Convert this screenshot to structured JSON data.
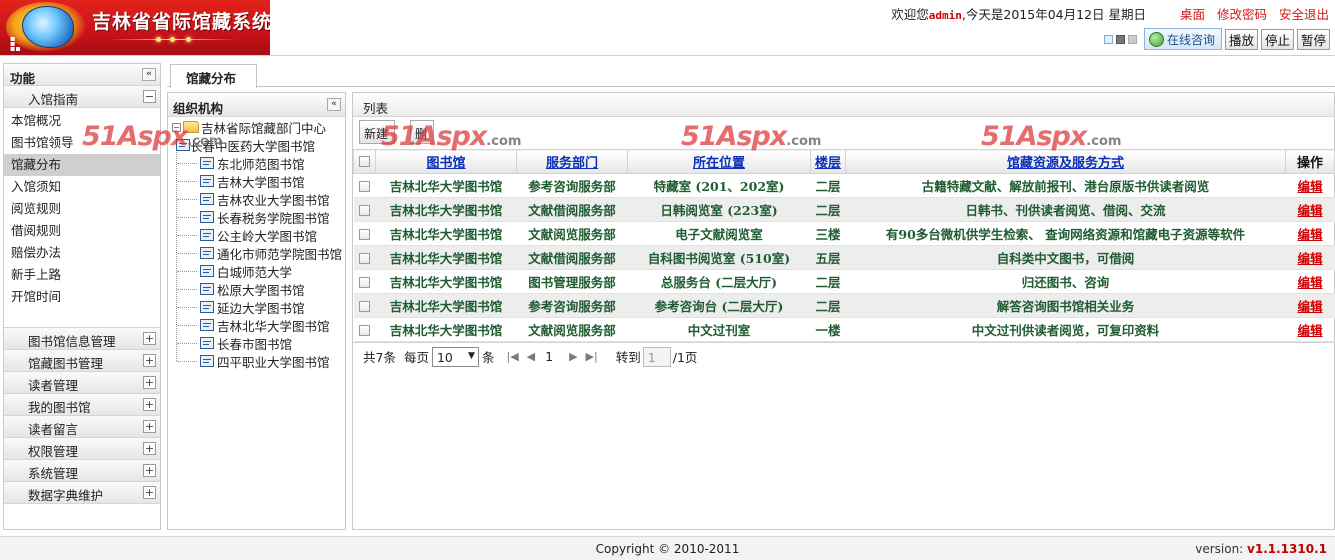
{
  "header": {
    "logo_title": "吉林省省际馆藏系统",
    "welcome_prefix": "欢迎您",
    "username": "admin",
    "date_text": ",今天是2015年04月12日  星期日",
    "links": [
      "桌面",
      "修改密码",
      "安全退出"
    ],
    "consult_label": "在线咨询",
    "play_label": "播放",
    "stop_label": "停止",
    "pause_label": "暂停"
  },
  "leftnav": {
    "title": "功能",
    "guide_title": "入馆指南",
    "guide_items": [
      "本馆概况",
      "图书馆领导",
      "馆藏分布",
      "入馆须知",
      "阅览规则",
      "借阅规则",
      "赔偿办法",
      "新手上路",
      "开馆时间"
    ],
    "sections": [
      "图书馆信息管理",
      "馆藏图书管理",
      "读者管理",
      "我的图书馆",
      "读者留言",
      "权限管理",
      "系统管理",
      "数据字典维护"
    ]
  },
  "tab": {
    "label": "馆藏分布"
  },
  "tree": {
    "title": "组织机构",
    "root": "吉林省际馆藏部门中心",
    "children": [
      "长春中医药大学图书馆",
      "东北师范图书馆",
      "吉林大学图书馆",
      "吉林农业大学图书馆",
      "长春税务学院图书馆",
      "公主岭大学图书馆",
      "通化市师范学院图书馆",
      "白城师范大学",
      "松原大学图书馆",
      "延边大学图书馆",
      "吉林北华大学图书馆",
      "长春市图书馆",
      "四平职业大学图书馆"
    ]
  },
  "list": {
    "title": "列表",
    "new_label": "新建",
    "delete_label": "删除",
    "columns": [
      "图书馆",
      "服务部门",
      "所在位置",
      "楼层",
      "馆藏资源及服务方式",
      "操作"
    ],
    "rows": [
      [
        "吉林北华大学图书馆",
        "参考咨询服务部",
        "特藏室 (201、202室)",
        "二层",
        "古籍特藏文献、解放前报刊、港台原版书供读者阅览",
        "编辑"
      ],
      [
        "吉林北华大学图书馆",
        "文献借阅服务部",
        "日韩阅览室 (223室)",
        "二层",
        "日韩书、刊供读者阅览、借阅、交流",
        "编辑"
      ],
      [
        "吉林北华大学图书馆",
        "文献阅览服务部",
        "电子文献阅览室",
        "三楼",
        "有90多台微机供学生检索、 查询网络资源和馆藏电子资源等软件",
        "编辑"
      ],
      [
        "吉林北华大学图书馆",
        "文献借阅服务部",
        "自科图书阅览室 (510室)",
        "五层",
        "自科类中文图书，可借阅",
        "编辑"
      ],
      [
        "吉林北华大学图书馆",
        "图书管理服务部",
        "总服务台 (二层大厅)",
        "二层",
        "归还图书、咨询",
        "编辑"
      ],
      [
        "吉林北华大学图书馆",
        "参考咨询服务部",
        "参考咨询台 (二层大厅)",
        "二层",
        "解答咨询图书馆相关业务",
        "编辑"
      ],
      [
        "吉林北华大学图书馆",
        "文献阅览服务部",
        "中文过刊室",
        "一楼",
        "中文过刊供读者阅览，可复印资料",
        "编辑"
      ]
    ]
  },
  "pager": {
    "total": "共7条",
    "per_page_label": "每页",
    "per_page_value": "10",
    "unit": "条",
    "current_page": "1",
    "goto_label": "转到",
    "goto_value": "1",
    "total_pages": "/1页"
  },
  "footer": {
    "copyright": "Copyright © 2010-2011",
    "version_label": "version: ",
    "version": "v1.1.1310.1"
  },
  "watermark": {
    "text": "51Aspx",
    "suffix": ".com"
  }
}
